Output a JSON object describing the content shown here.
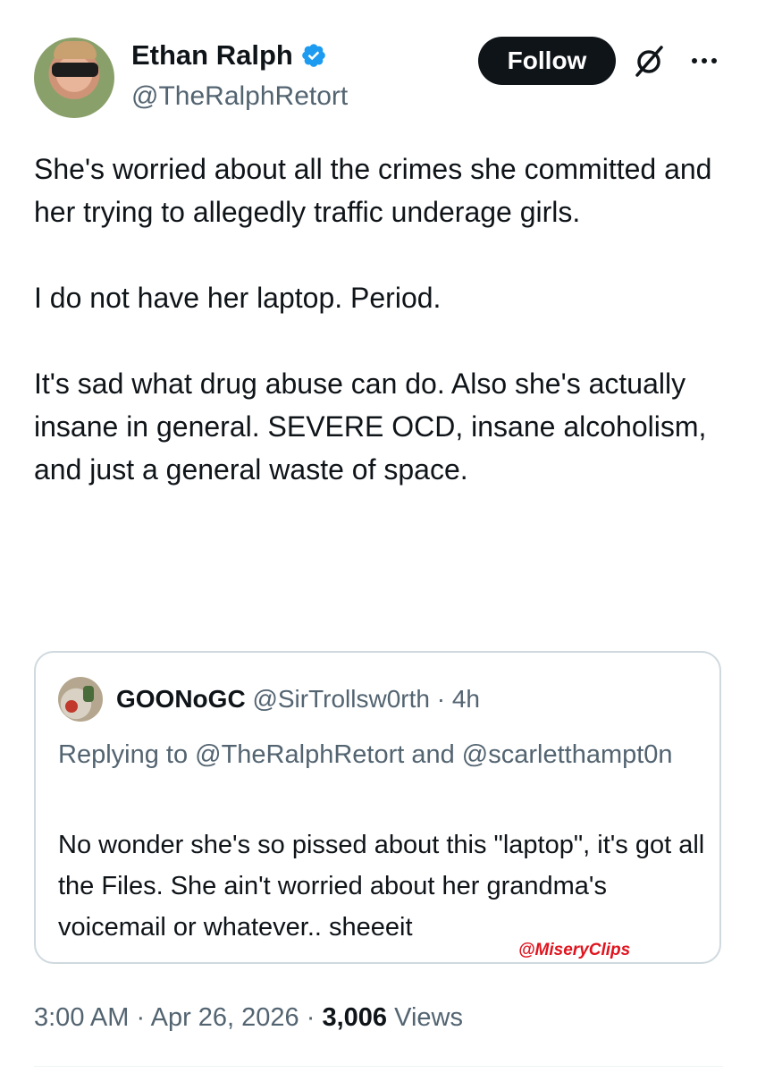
{
  "author": {
    "name": "Ethan Ralph",
    "handle": "@TheRalphRetort",
    "verified_icon": "verified-badge-icon"
  },
  "actions": {
    "follow_label": "Follow",
    "grok_icon": "grok-icon",
    "more_icon": "more-options-icon"
  },
  "tweet": {
    "paragraphs": [
      "She's worried about all the crimes she committed and her trying to allegedly traffic underage girls.",
      "I do not have her laptop. Period.",
      "It's sad what drug abuse can do. Also she's actually insane in general. SEVERE OCD, insane alcoholism, and just a general waste of space."
    ]
  },
  "quote": {
    "name": "GOONoGC",
    "handle": "@SirTrollsw0rth",
    "separator": "·",
    "time": "4h",
    "replying_to": "Replying to @TheRalphRetort and @scarletthampt0n",
    "text": "No wonder she's so pissed about this \"laptop\", it's got all the Files. She ain't worried about her grandma's voicemail or whatever.. sheeeit"
  },
  "watermark": "@MiseryClips",
  "meta": {
    "time": "3:00 AM",
    "date": "Apr 26, 2026",
    "separator": "·",
    "views_count": "3,006",
    "views_label": "Views"
  },
  "colors": {
    "text": "#0f1419",
    "secondary": "#536471",
    "verified": "#1d9bf0",
    "follow_bg": "#0f1419",
    "border": "#cfd9de",
    "watermark": "#e0141e"
  }
}
